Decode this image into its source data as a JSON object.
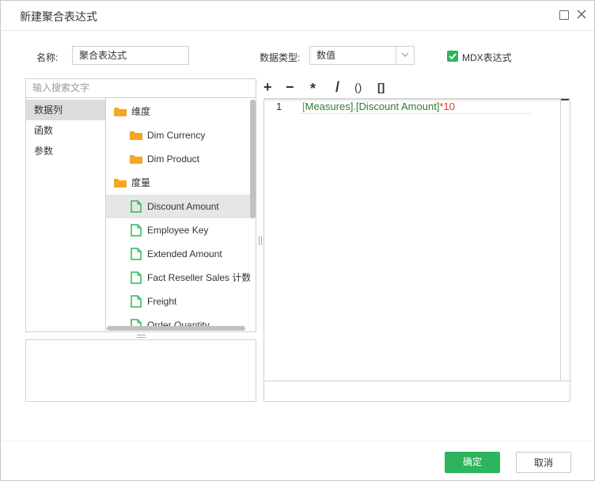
{
  "window": {
    "title": "新建聚合表达式"
  },
  "form": {
    "name_label": "名称:",
    "name_value": "聚合表达式",
    "datatype_label": "数据类型:",
    "datatype_value": "数值",
    "mdx_label": "MDX表达式",
    "mdx_checked": true
  },
  "search": {
    "placeholder": "输入搜索文字"
  },
  "categories": [
    {
      "label": "数据列",
      "selected": true
    },
    {
      "label": "函数",
      "selected": false
    },
    {
      "label": "参数",
      "selected": false
    }
  ],
  "tree": [
    {
      "label": "维度",
      "type": "folder",
      "level": 0
    },
    {
      "label": "Dim Currency",
      "type": "folder",
      "level": 1
    },
    {
      "label": "Dim Product",
      "type": "folder",
      "level": 1
    },
    {
      "label": "度量",
      "type": "folder",
      "level": 0
    },
    {
      "label": "Discount Amount",
      "type": "measure",
      "level": 1,
      "selected": true
    },
    {
      "label": "Employee Key",
      "type": "measure",
      "level": 1
    },
    {
      "label": "Extended Amount",
      "type": "measure",
      "level": 1
    },
    {
      "label": "Fact Reseller Sales 计数",
      "type": "measure",
      "level": 1
    },
    {
      "label": "Freight",
      "type": "measure",
      "level": 1
    },
    {
      "label": "Order Quantity",
      "type": "measure",
      "level": 1
    }
  ],
  "operators": [
    "+",
    "−",
    "*",
    "/",
    "()",
    "[]"
  ],
  "editor": {
    "line_number": "1",
    "code_field": "[Measures].[Discount Amount]",
    "code_operator": "*",
    "code_number": "10"
  },
  "buttons": {
    "ok": "确定",
    "cancel": "取消"
  },
  "colors": {
    "accent": "#2db55d",
    "folder": "#f5a623",
    "measure": "#2db55d",
    "code_number": "#e53935",
    "code_field": "#2e7d32",
    "code_bracket": "#2db55d"
  }
}
